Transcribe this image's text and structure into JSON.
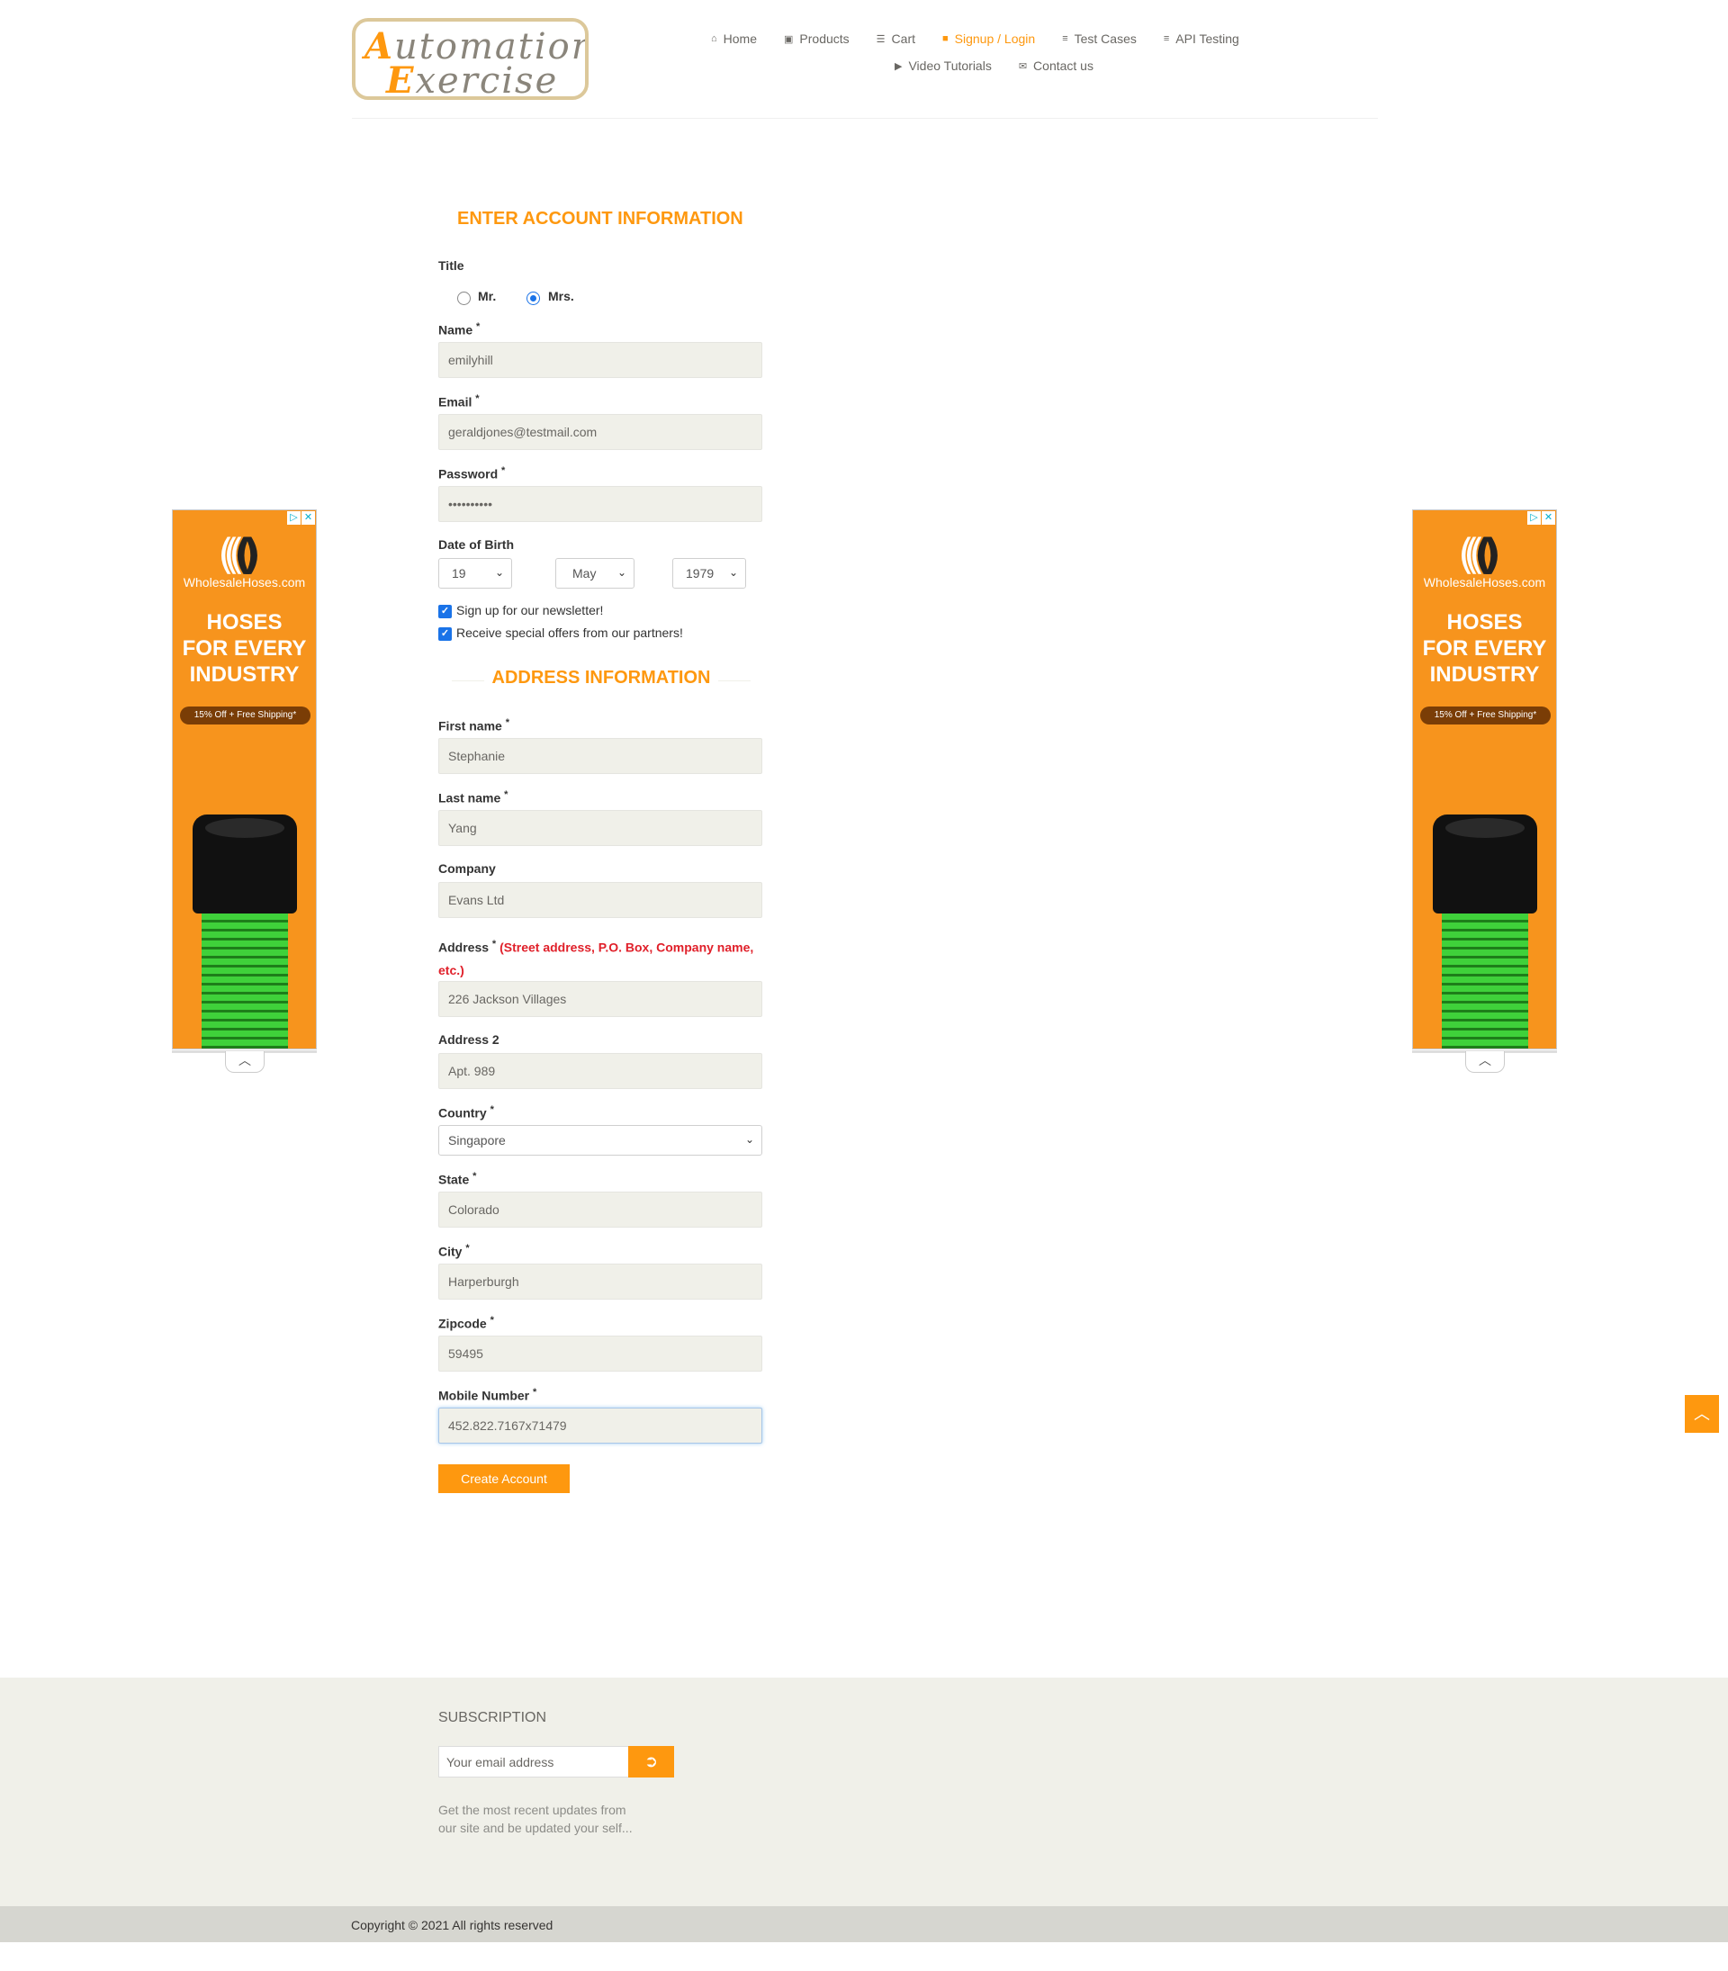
{
  "logo": {
    "line1_cap": "A",
    "line1": "utomation",
    "line2_cap": "E",
    "line2": "xercise"
  },
  "nav": {
    "row1": [
      {
        "label": "Home",
        "icon": "home-icon",
        "glyph": "⌂"
      },
      {
        "label": "Products",
        "icon": "products-icon",
        "glyph": "▣"
      },
      {
        "label": "Cart",
        "icon": "cart-icon",
        "glyph": "☰"
      },
      {
        "label": "Signup / Login",
        "icon": "lock-icon",
        "glyph": "■",
        "active": true
      },
      {
        "label": "Test Cases",
        "icon": "list-icon",
        "glyph": "≡"
      },
      {
        "label": "API Testing",
        "icon": "list-icon",
        "glyph": "≡"
      }
    ],
    "row2": [
      {
        "label": "Video Tutorials",
        "icon": "youtube-icon",
        "glyph": "▶"
      },
      {
        "label": "Contact us",
        "icon": "envelope-icon",
        "glyph": "✉"
      }
    ]
  },
  "form": {
    "title": "ENTER ACCOUNT INFORMATION",
    "title_label": "Title",
    "mr": "Mr.",
    "mrs": "Mrs.",
    "name_label": "Name",
    "name_value": "emilyhill",
    "email_label": "Email",
    "email_value": "geraldjones@testmail.com",
    "password_label": "Password",
    "password_value": "••••••••••",
    "dob_label": "Date of Birth",
    "dob_day": "19",
    "dob_month": "May",
    "dob_year": "1979",
    "newsletter": "Sign up for our newsletter!",
    "offers": "Receive special offers from our partners!",
    "required_mark": "*"
  },
  "address": {
    "title": "ADDRESS INFORMATION",
    "first_name_label": "First name",
    "first_name_value": "Stephanie",
    "last_name_label": "Last name",
    "last_name_value": "Yang",
    "company_label": "Company",
    "company_value": "Evans Ltd",
    "address_label": "Address",
    "address_note_1": "(Street address, P.O. Box, Company name,",
    "address_note_2": "etc.)",
    "address_value": "226 Jackson Villages",
    "address2_label": "Address 2",
    "address2_value": "Apt. 989",
    "country_label": "Country",
    "country_value": "Singapore",
    "state_label": "State",
    "state_value": "Colorado",
    "city_label": "City",
    "city_value": "Harperburgh",
    "zipcode_label": "Zipcode",
    "zipcode_value": "59495",
    "mobile_label": "Mobile Number",
    "mobile_value": "452.822.7167x71479",
    "create_button": "Create Account"
  },
  "ad": {
    "brand": "WholesaleHoses.com",
    "head1": "HOSES",
    "head2": "FOR EVERY",
    "head3": "INDUSTRY",
    "promo": "15% Off + Free Shipping*"
  },
  "footer": {
    "subscription_title": "SUBSCRIPTION",
    "email_placeholder": "Your email address",
    "subscription_text_1": "Get the most recent updates from",
    "subscription_text_2": "our site and be updated your self...",
    "copyright": "Copyright © 2021 All rights reserved"
  },
  "colors": {
    "accent": "#fe980f",
    "input_bg": "#f0f0e9",
    "footer_bg": "#f0f0e9",
    "footer_bottom": "#d6d6d0",
    "note_red": "#e0202a"
  }
}
